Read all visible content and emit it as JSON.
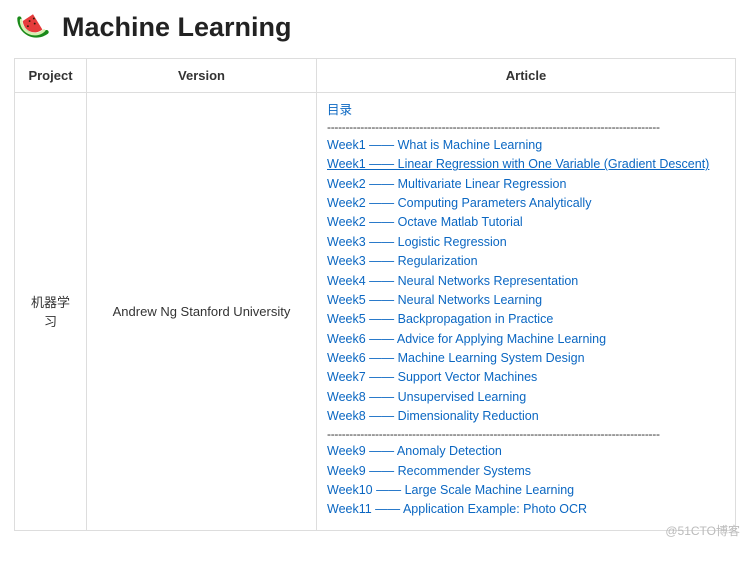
{
  "header": {
    "title": "Machine Learning"
  },
  "table": {
    "columns": [
      "Project",
      "Version",
      "Article"
    ],
    "project": "机器学习",
    "version": "Andrew Ng Stanford University",
    "article": {
      "toc": "目录",
      "separator": "------------------------------------------------------------------------------------------",
      "group1": [
        "Week1 —— What is Machine Learning",
        "Week1 —— Linear Regression with One Variable (Gradient Descent)",
        "Week2 —— Multivariate Linear Regression",
        "Week2 —— Computing Parameters Analytically",
        "Week2 —— Octave Matlab Tutorial",
        "Week3 —— Logistic Regression",
        "Week3 —— Regularization",
        "Week4 —— Neural Networks Representation",
        "Week5 —— Neural Networks Learning",
        "Week5 —— Backpropagation in Practice",
        "Week6 —— Advice for Applying Machine Learning",
        "Week6 —— Machine Learning System Design",
        "Week7 —— Support Vector Machines",
        "Week8 —— Unsupervised Learning",
        "Week8 —— Dimensionality Reduction"
      ],
      "group2": [
        "Week9 —— Anomaly Detection",
        "Week9 —— Recommender Systems",
        "Week10 —— Large Scale Machine Learning",
        "Week11 —— Application Example: Photo OCR"
      ],
      "hover_index": 1
    }
  },
  "watermark": "@51CTO博客"
}
